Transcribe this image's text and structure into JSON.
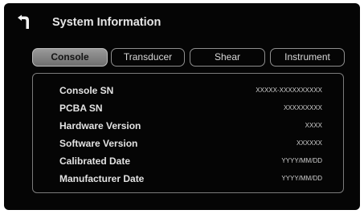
{
  "header": {
    "back_icon": "back-arrow-icon",
    "title": "System Information"
  },
  "tabs": [
    {
      "label": "Console",
      "active": true
    },
    {
      "label": "Transducer",
      "active": false
    },
    {
      "label": "Shear",
      "active": false
    },
    {
      "label": "Instrument",
      "active": false
    }
  ],
  "info": [
    {
      "label": "Console SN",
      "value": "XXXXX-XXXXXXXXXX"
    },
    {
      "label": "PCBA SN",
      "value": "XXXXXXXXX"
    },
    {
      "label": "Hardware Version",
      "value": "XXXX"
    },
    {
      "label": "Software Version",
      "value": "XXXXXX"
    },
    {
      "label": "Calibrated Date",
      "value": "YYYY/MM/DD"
    },
    {
      "label": "Manufacturer Date",
      "value": "YYYY/MM/DD"
    }
  ],
  "colors": {
    "background": "#050505",
    "text": "#e3e3e3",
    "tab_border": "#8f8f8f",
    "tab_active_bg": "#8a8a8a",
    "panel_border": "#7c7c7c"
  }
}
